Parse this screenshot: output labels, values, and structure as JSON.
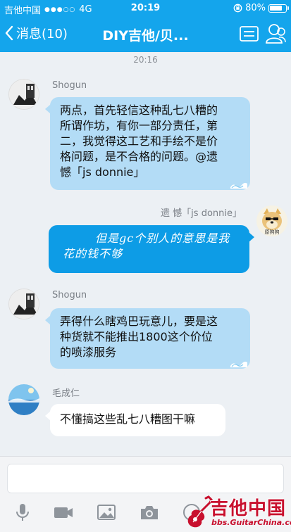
{
  "status_bar": {
    "carrier": "吉他中国",
    "signal_dots": "●●●○○",
    "network": "4G",
    "time": "20:19",
    "battery": "80%"
  },
  "nav": {
    "back_label": "消息(10)",
    "title": "DIY吉他/贝..."
  },
  "timestamp": "20:16",
  "messages": [
    {
      "sender": "Shogun",
      "text_lines": [
        "两点，首先轻信这种乱七八糟的",
        "所谓作坊，有你一部分责任，第",
        "二，我觉得这工艺和手绘不是价",
        "格问题，是不合格的问题。@遗",
        "憾「js donnie」"
      ]
    },
    {
      "sender": "遗 憾「js donnie」",
      "avatar_caption": "原狗狗",
      "text_lines": [
        "但是gc个别人的意思是我",
        "花的钱不够"
      ]
    },
    {
      "sender": "Shogun",
      "text_lines": [
        "弄得什么瞎鸡巴玩意儿，要是这",
        "种货就不能推出1800这个价位",
        "的喷漆服务"
      ]
    },
    {
      "sender": "毛成仁",
      "text_lines": [
        "不懂搞这些乱七八糟图干嘛"
      ]
    }
  ],
  "input": {
    "placeholder": ""
  },
  "toolbar": [
    "microphone-icon",
    "video-icon",
    "image-icon",
    "camera-icon",
    "emoji-icon"
  ],
  "watermark": {
    "brand": "吉他中国",
    "url": "bbs.GuitarChina.com"
  },
  "colors": {
    "accent": "#14a5ec",
    "bubble_blue": "#b3dcf6",
    "bubble_self": "#0d9ce6",
    "watermark_red": "#c8102e"
  }
}
